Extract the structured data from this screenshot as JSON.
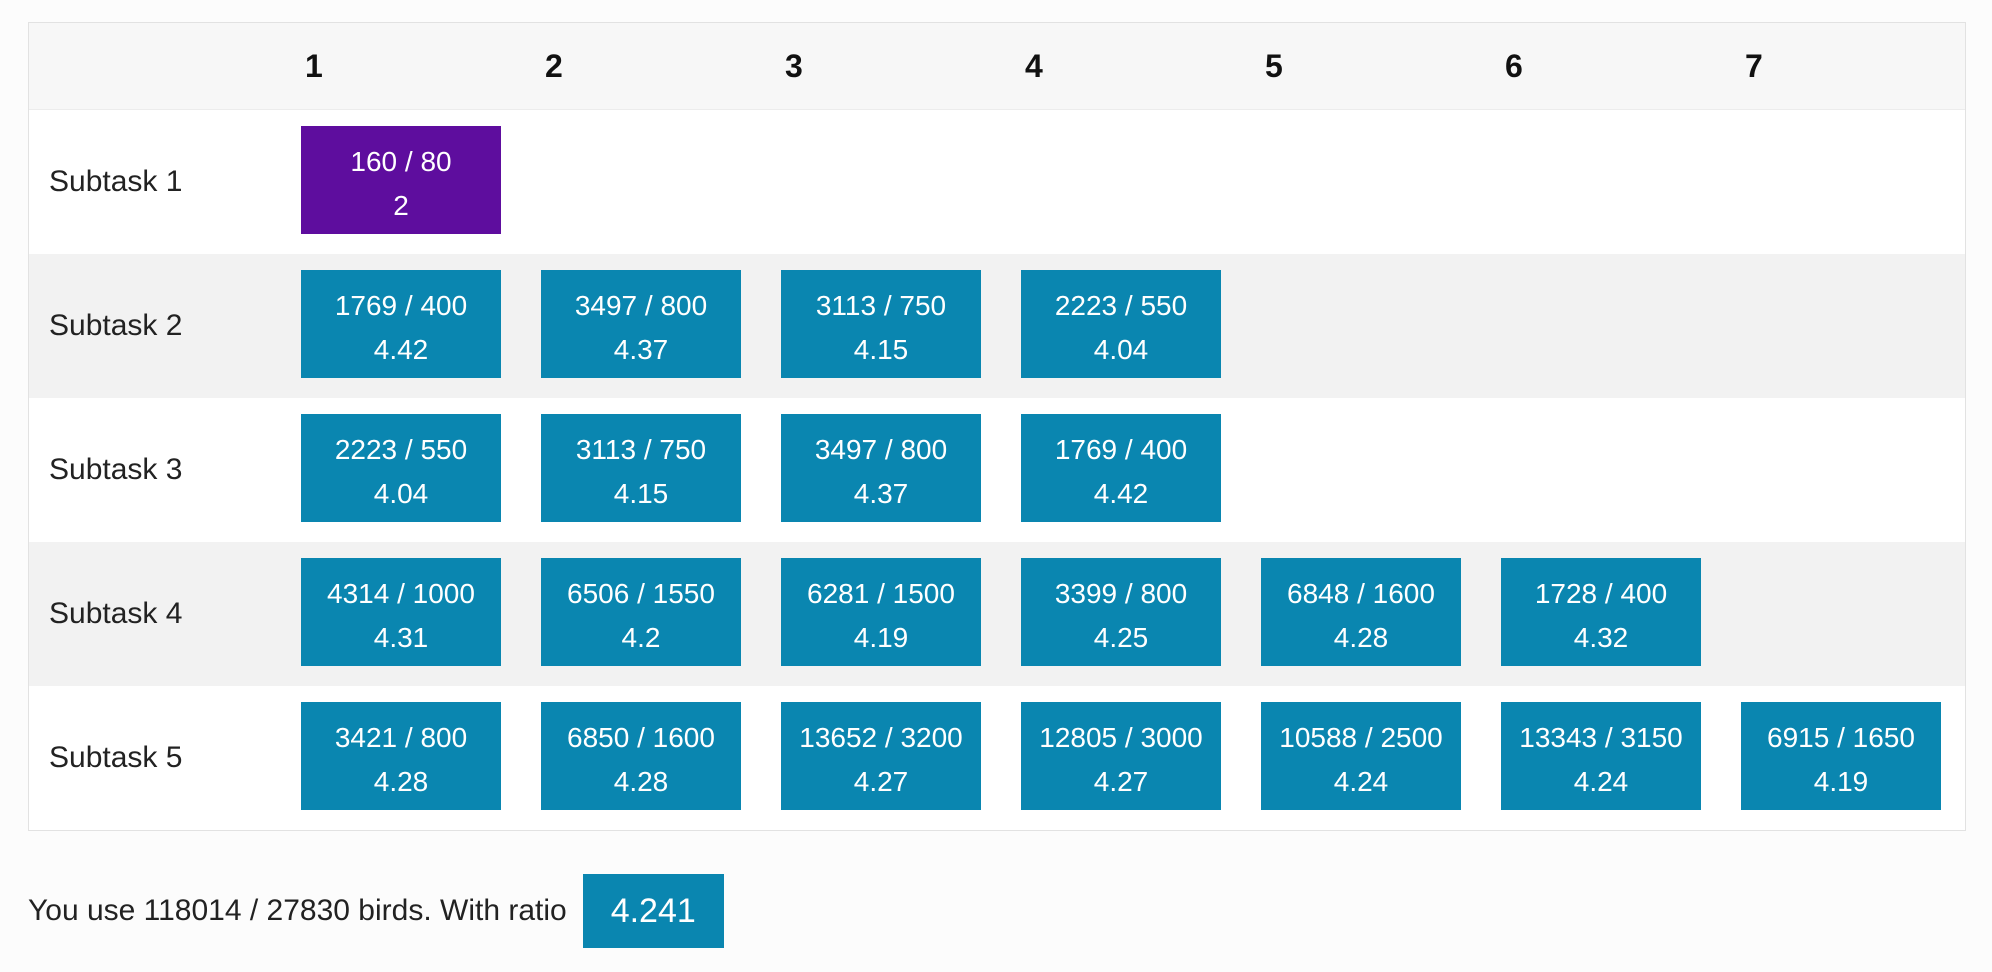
{
  "colors": {
    "cell_default": "#0a86b0",
    "cell_highlight": "#5e0d9e"
  },
  "columns": [
    "1",
    "2",
    "3",
    "4",
    "5",
    "6",
    "7"
  ],
  "rows": [
    {
      "label": "Subtask 1",
      "cells": [
        {
          "fraction": "160 / 80",
          "ratio": "2",
          "style": "highlight"
        }
      ]
    },
    {
      "label": "Subtask 2",
      "cells": [
        {
          "fraction": "1769 / 400",
          "ratio": "4.42",
          "style": "default"
        },
        {
          "fraction": "3497 / 800",
          "ratio": "4.37",
          "style": "default"
        },
        {
          "fraction": "3113 / 750",
          "ratio": "4.15",
          "style": "default"
        },
        {
          "fraction": "2223 / 550",
          "ratio": "4.04",
          "style": "default"
        }
      ]
    },
    {
      "label": "Subtask 3",
      "cells": [
        {
          "fraction": "2223 / 550",
          "ratio": "4.04",
          "style": "default"
        },
        {
          "fraction": "3113 / 750",
          "ratio": "4.15",
          "style": "default"
        },
        {
          "fraction": "3497 / 800",
          "ratio": "4.37",
          "style": "default"
        },
        {
          "fraction": "1769 / 400",
          "ratio": "4.42",
          "style": "default"
        }
      ]
    },
    {
      "label": "Subtask 4",
      "cells": [
        {
          "fraction": "4314 / 1000",
          "ratio": "4.31",
          "style": "default"
        },
        {
          "fraction": "6506 / 1550",
          "ratio": "4.2",
          "style": "default"
        },
        {
          "fraction": "6281 / 1500",
          "ratio": "4.19",
          "style": "default"
        },
        {
          "fraction": "3399 / 800",
          "ratio": "4.25",
          "style": "default"
        },
        {
          "fraction": "6848 / 1600",
          "ratio": "4.28",
          "style": "default"
        },
        {
          "fraction": "1728 / 400",
          "ratio": "4.32",
          "style": "default"
        }
      ]
    },
    {
      "label": "Subtask 5",
      "cells": [
        {
          "fraction": "3421 / 800",
          "ratio": "4.28",
          "style": "default"
        },
        {
          "fraction": "6850 / 1600",
          "ratio": "4.28",
          "style": "default"
        },
        {
          "fraction": "13652 / 3200",
          "ratio": "4.27",
          "style": "default"
        },
        {
          "fraction": "12805 / 3000",
          "ratio": "4.27",
          "style": "default"
        },
        {
          "fraction": "10588 / 2500",
          "ratio": "4.24",
          "style": "default"
        },
        {
          "fraction": "13343 / 3150",
          "ratio": "4.24",
          "style": "default"
        },
        {
          "fraction": "6915 / 1650",
          "ratio": "4.19",
          "style": "default"
        }
      ]
    }
  ],
  "summary": {
    "text": "You use 118014 / 27830 birds. With ratio",
    "ratio": "4.241"
  }
}
